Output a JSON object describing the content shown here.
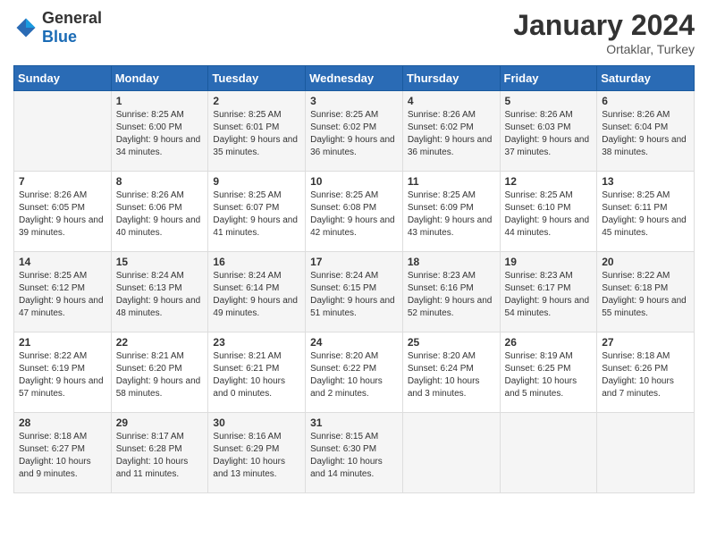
{
  "header": {
    "logo_general": "General",
    "logo_blue": "Blue",
    "month_year": "January 2024",
    "location": "Ortaklar, Turkey"
  },
  "calendar": {
    "days_of_week": [
      "Sunday",
      "Monday",
      "Tuesday",
      "Wednesday",
      "Thursday",
      "Friday",
      "Saturday"
    ],
    "weeks": [
      [
        {
          "day": "",
          "info": ""
        },
        {
          "day": "1",
          "info": "Sunrise: 8:25 AM\nSunset: 6:00 PM\nDaylight: 9 hours and 34 minutes."
        },
        {
          "day": "2",
          "info": "Sunrise: 8:25 AM\nSunset: 6:01 PM\nDaylight: 9 hours and 35 minutes."
        },
        {
          "day": "3",
          "info": "Sunrise: 8:25 AM\nSunset: 6:02 PM\nDaylight: 9 hours and 36 minutes."
        },
        {
          "day": "4",
          "info": "Sunrise: 8:26 AM\nSunset: 6:02 PM\nDaylight: 9 hours and 36 minutes."
        },
        {
          "day": "5",
          "info": "Sunrise: 8:26 AM\nSunset: 6:03 PM\nDaylight: 9 hours and 37 minutes."
        },
        {
          "day": "6",
          "info": "Sunrise: 8:26 AM\nSunset: 6:04 PM\nDaylight: 9 hours and 38 minutes."
        }
      ],
      [
        {
          "day": "7",
          "info": ""
        },
        {
          "day": "8",
          "info": "Sunrise: 8:26 AM\nSunset: 6:06 PM\nDaylight: 9 hours and 40 minutes."
        },
        {
          "day": "9",
          "info": "Sunrise: 8:25 AM\nSunset: 6:07 PM\nDaylight: 9 hours and 41 minutes."
        },
        {
          "day": "10",
          "info": "Sunrise: 8:25 AM\nSunset: 6:08 PM\nDaylight: 9 hours and 42 minutes."
        },
        {
          "day": "11",
          "info": "Sunrise: 8:25 AM\nSunset: 6:09 PM\nDaylight: 9 hours and 43 minutes."
        },
        {
          "day": "12",
          "info": "Sunrise: 8:25 AM\nSunset: 6:10 PM\nDaylight: 9 hours and 44 minutes."
        },
        {
          "day": "13",
          "info": "Sunrise: 8:25 AM\nSunset: 6:11 PM\nDaylight: 9 hours and 45 minutes."
        }
      ],
      [
        {
          "day": "14",
          "info": ""
        },
        {
          "day": "15",
          "info": "Sunrise: 8:24 AM\nSunset: 6:13 PM\nDaylight: 9 hours and 48 minutes."
        },
        {
          "day": "16",
          "info": "Sunrise: 8:24 AM\nSunset: 6:14 PM\nDaylight: 9 hours and 49 minutes."
        },
        {
          "day": "17",
          "info": "Sunrise: 8:24 AM\nSunset: 6:15 PM\nDaylight: 9 hours and 51 minutes."
        },
        {
          "day": "18",
          "info": "Sunrise: 8:23 AM\nSunset: 6:16 PM\nDaylight: 9 hours and 52 minutes."
        },
        {
          "day": "19",
          "info": "Sunrise: 8:23 AM\nSunset: 6:17 PM\nDaylight: 9 hours and 54 minutes."
        },
        {
          "day": "20",
          "info": "Sunrise: 8:22 AM\nSunset: 6:18 PM\nDaylight: 9 hours and 55 minutes."
        }
      ],
      [
        {
          "day": "21",
          "info": ""
        },
        {
          "day": "22",
          "info": "Sunrise: 8:21 AM\nSunset: 6:20 PM\nDaylight: 9 hours and 58 minutes."
        },
        {
          "day": "23",
          "info": "Sunrise: 8:21 AM\nSunset: 6:21 PM\nDaylight: 10 hours and 0 minutes."
        },
        {
          "day": "24",
          "info": "Sunrise: 8:20 AM\nSunset: 6:22 PM\nDaylight: 10 hours and 2 minutes."
        },
        {
          "day": "25",
          "info": "Sunrise: 8:20 AM\nSunset: 6:24 PM\nDaylight: 10 hours and 3 minutes."
        },
        {
          "day": "26",
          "info": "Sunrise: 8:19 AM\nSunset: 6:25 PM\nDaylight: 10 hours and 5 minutes."
        },
        {
          "day": "27",
          "info": "Sunrise: 8:18 AM\nSunset: 6:26 PM\nDaylight: 10 hours and 7 minutes."
        }
      ],
      [
        {
          "day": "28",
          "info": ""
        },
        {
          "day": "29",
          "info": "Sunrise: 8:17 AM\nSunset: 6:28 PM\nDaylight: 10 hours and 11 minutes."
        },
        {
          "day": "30",
          "info": "Sunrise: 8:16 AM\nSunset: 6:29 PM\nDaylight: 10 hours and 13 minutes."
        },
        {
          "day": "31",
          "info": "Sunrise: 8:15 AM\nSunset: 6:30 PM\nDaylight: 10 hours and 14 minutes."
        },
        {
          "day": "",
          "info": ""
        },
        {
          "day": "",
          "info": ""
        },
        {
          "day": "",
          "info": ""
        }
      ]
    ],
    "week_sunday_info": [
      "Sunrise: 8:26 AM\nSunset: 6:05 PM\nDaylight: 9 hours and 39 minutes.",
      "Sunrise: 8:25 AM\nSunset: 6:12 PM\nDaylight: 9 hours and 47 minutes.",
      "Sunrise: 8:22 AM\nSunset: 6:19 PM\nDaylight: 9 hours and 57 minutes.",
      "Sunrise: 8:18 AM\nSunset: 6:27 PM\nDaylight: 10 hours and 9 minutes."
    ]
  }
}
